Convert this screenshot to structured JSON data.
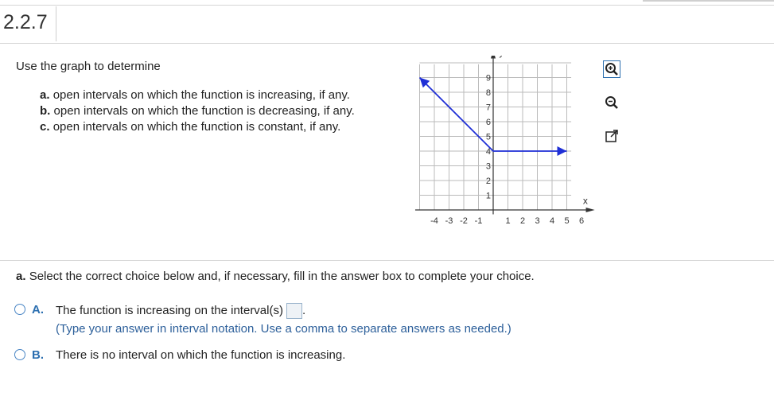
{
  "header": {
    "section_number": "2.2.7"
  },
  "problem": {
    "prompt": "Use the graph to determine",
    "parts": [
      {
        "letter": "a.",
        "text": "open intervals on which the function is increasing, if any."
      },
      {
        "letter": "b.",
        "text": "open intervals on which the function is decreasing, if any."
      },
      {
        "letter": "c.",
        "text": "open intervals on which the function is constant, if any."
      }
    ]
  },
  "graph": {
    "x_axis_label": "x",
    "y_axis_label": "y",
    "x_tick_labels": [
      "-4",
      "-3",
      "-2",
      "-1",
      "1",
      "2",
      "3",
      "4",
      "5",
      "6"
    ],
    "y_tick_labels": [
      "1",
      "2",
      "3",
      "4",
      "5",
      "6",
      "7",
      "8",
      "9"
    ],
    "curve_points": [
      [
        -5,
        9
      ],
      [
        0,
        4
      ],
      [
        5,
        4
      ]
    ],
    "curve_color": "#1f2fd6"
  },
  "tools": [
    {
      "name": "zoom-in-icon"
    },
    {
      "name": "zoom-out-icon"
    },
    {
      "name": "popout-icon"
    }
  ],
  "question": {
    "letter": "a.",
    "text": "Select the correct choice below and, if necessary, fill in the answer box to complete your choice."
  },
  "choices": [
    {
      "letter": "A.",
      "text": "The function is increasing on the interval(s)",
      "hint": "(Type your answer in interval notation. Use a comma to separate answers as needed.)"
    },
    {
      "letter": "B.",
      "text": "There is no interval on which the function is increasing."
    }
  ]
}
